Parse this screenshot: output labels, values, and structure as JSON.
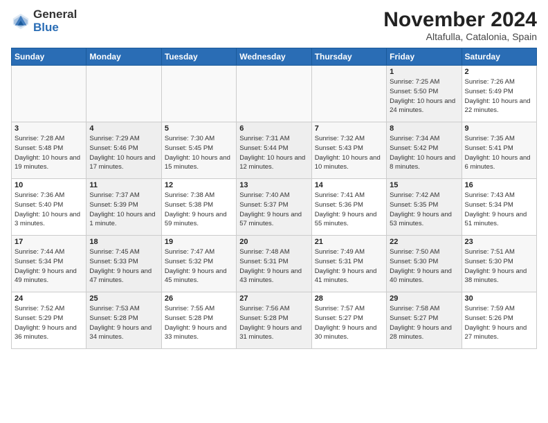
{
  "header": {
    "logo_general": "General",
    "logo_blue": "Blue",
    "month_title": "November 2024",
    "location": "Altafulla, Catalonia, Spain"
  },
  "days_of_week": [
    "Sunday",
    "Monday",
    "Tuesday",
    "Wednesday",
    "Thursday",
    "Friday",
    "Saturday"
  ],
  "weeks": [
    [
      {
        "day": "",
        "info": ""
      },
      {
        "day": "",
        "info": ""
      },
      {
        "day": "",
        "info": ""
      },
      {
        "day": "",
        "info": ""
      },
      {
        "day": "",
        "info": ""
      },
      {
        "day": "1",
        "info": "Sunrise: 7:25 AM\nSunset: 5:50 PM\nDaylight: 10 hours and 24 minutes."
      },
      {
        "day": "2",
        "info": "Sunrise: 7:26 AM\nSunset: 5:49 PM\nDaylight: 10 hours and 22 minutes."
      }
    ],
    [
      {
        "day": "3",
        "info": "Sunrise: 7:28 AM\nSunset: 5:48 PM\nDaylight: 10 hours and 19 minutes."
      },
      {
        "day": "4",
        "info": "Sunrise: 7:29 AM\nSunset: 5:46 PM\nDaylight: 10 hours and 17 minutes."
      },
      {
        "day": "5",
        "info": "Sunrise: 7:30 AM\nSunset: 5:45 PM\nDaylight: 10 hours and 15 minutes."
      },
      {
        "day": "6",
        "info": "Sunrise: 7:31 AM\nSunset: 5:44 PM\nDaylight: 10 hours and 12 minutes."
      },
      {
        "day": "7",
        "info": "Sunrise: 7:32 AM\nSunset: 5:43 PM\nDaylight: 10 hours and 10 minutes."
      },
      {
        "day": "8",
        "info": "Sunrise: 7:34 AM\nSunset: 5:42 PM\nDaylight: 10 hours and 8 minutes."
      },
      {
        "day": "9",
        "info": "Sunrise: 7:35 AM\nSunset: 5:41 PM\nDaylight: 10 hours and 6 minutes."
      }
    ],
    [
      {
        "day": "10",
        "info": "Sunrise: 7:36 AM\nSunset: 5:40 PM\nDaylight: 10 hours and 3 minutes."
      },
      {
        "day": "11",
        "info": "Sunrise: 7:37 AM\nSunset: 5:39 PM\nDaylight: 10 hours and 1 minute."
      },
      {
        "day": "12",
        "info": "Sunrise: 7:38 AM\nSunset: 5:38 PM\nDaylight: 9 hours and 59 minutes."
      },
      {
        "day": "13",
        "info": "Sunrise: 7:40 AM\nSunset: 5:37 PM\nDaylight: 9 hours and 57 minutes."
      },
      {
        "day": "14",
        "info": "Sunrise: 7:41 AM\nSunset: 5:36 PM\nDaylight: 9 hours and 55 minutes."
      },
      {
        "day": "15",
        "info": "Sunrise: 7:42 AM\nSunset: 5:35 PM\nDaylight: 9 hours and 53 minutes."
      },
      {
        "day": "16",
        "info": "Sunrise: 7:43 AM\nSunset: 5:34 PM\nDaylight: 9 hours and 51 minutes."
      }
    ],
    [
      {
        "day": "17",
        "info": "Sunrise: 7:44 AM\nSunset: 5:34 PM\nDaylight: 9 hours and 49 minutes."
      },
      {
        "day": "18",
        "info": "Sunrise: 7:45 AM\nSunset: 5:33 PM\nDaylight: 9 hours and 47 minutes."
      },
      {
        "day": "19",
        "info": "Sunrise: 7:47 AM\nSunset: 5:32 PM\nDaylight: 9 hours and 45 minutes."
      },
      {
        "day": "20",
        "info": "Sunrise: 7:48 AM\nSunset: 5:31 PM\nDaylight: 9 hours and 43 minutes."
      },
      {
        "day": "21",
        "info": "Sunrise: 7:49 AM\nSunset: 5:31 PM\nDaylight: 9 hours and 41 minutes."
      },
      {
        "day": "22",
        "info": "Sunrise: 7:50 AM\nSunset: 5:30 PM\nDaylight: 9 hours and 40 minutes."
      },
      {
        "day": "23",
        "info": "Sunrise: 7:51 AM\nSunset: 5:30 PM\nDaylight: 9 hours and 38 minutes."
      }
    ],
    [
      {
        "day": "24",
        "info": "Sunrise: 7:52 AM\nSunset: 5:29 PM\nDaylight: 9 hours and 36 minutes."
      },
      {
        "day": "25",
        "info": "Sunrise: 7:53 AM\nSunset: 5:28 PM\nDaylight: 9 hours and 34 minutes."
      },
      {
        "day": "26",
        "info": "Sunrise: 7:55 AM\nSunset: 5:28 PM\nDaylight: 9 hours and 33 minutes."
      },
      {
        "day": "27",
        "info": "Sunrise: 7:56 AM\nSunset: 5:28 PM\nDaylight: 9 hours and 31 minutes."
      },
      {
        "day": "28",
        "info": "Sunrise: 7:57 AM\nSunset: 5:27 PM\nDaylight: 9 hours and 30 minutes."
      },
      {
        "day": "29",
        "info": "Sunrise: 7:58 AM\nSunset: 5:27 PM\nDaylight: 9 hours and 28 minutes."
      },
      {
        "day": "30",
        "info": "Sunrise: 7:59 AM\nSunset: 5:26 PM\nDaylight: 9 hours and 27 minutes."
      }
    ]
  ]
}
